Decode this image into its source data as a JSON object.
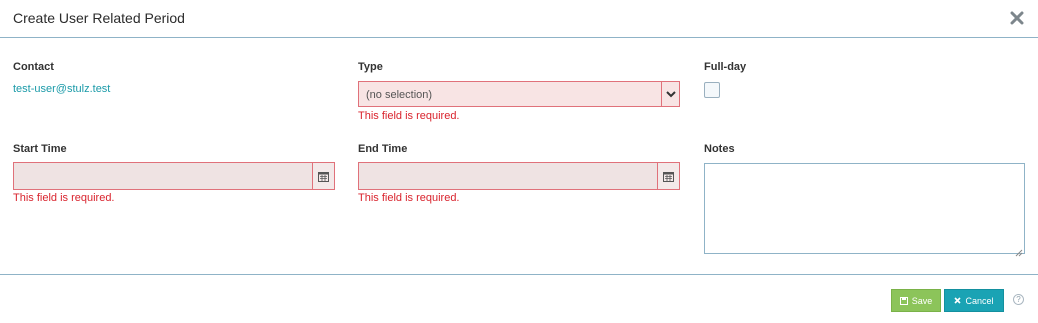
{
  "modal": {
    "title": "Create User Related Period",
    "close_icon": "close-icon"
  },
  "fields": {
    "contact": {
      "label": "Contact",
      "value": "test-user@stulz.test"
    },
    "type": {
      "label": "Type",
      "value": "(no selection)",
      "error": "This field is required."
    },
    "full_day": {
      "label": "Full-day",
      "checked": false
    },
    "start_time": {
      "label": "Start Time",
      "value": "",
      "error": "This field is required."
    },
    "end_time": {
      "label": "End Time",
      "value": "",
      "error": "This field is required."
    },
    "notes": {
      "label": "Notes",
      "value": ""
    }
  },
  "footer": {
    "save_label": "Save",
    "cancel_label": "Cancel",
    "help_glyph": "?"
  },
  "colors": {
    "accent": "#1aa3b4",
    "save": "#8cc45a",
    "error": "#d9232d",
    "error_bg": "#f8e4e4",
    "divider": "#8fb3c7"
  }
}
